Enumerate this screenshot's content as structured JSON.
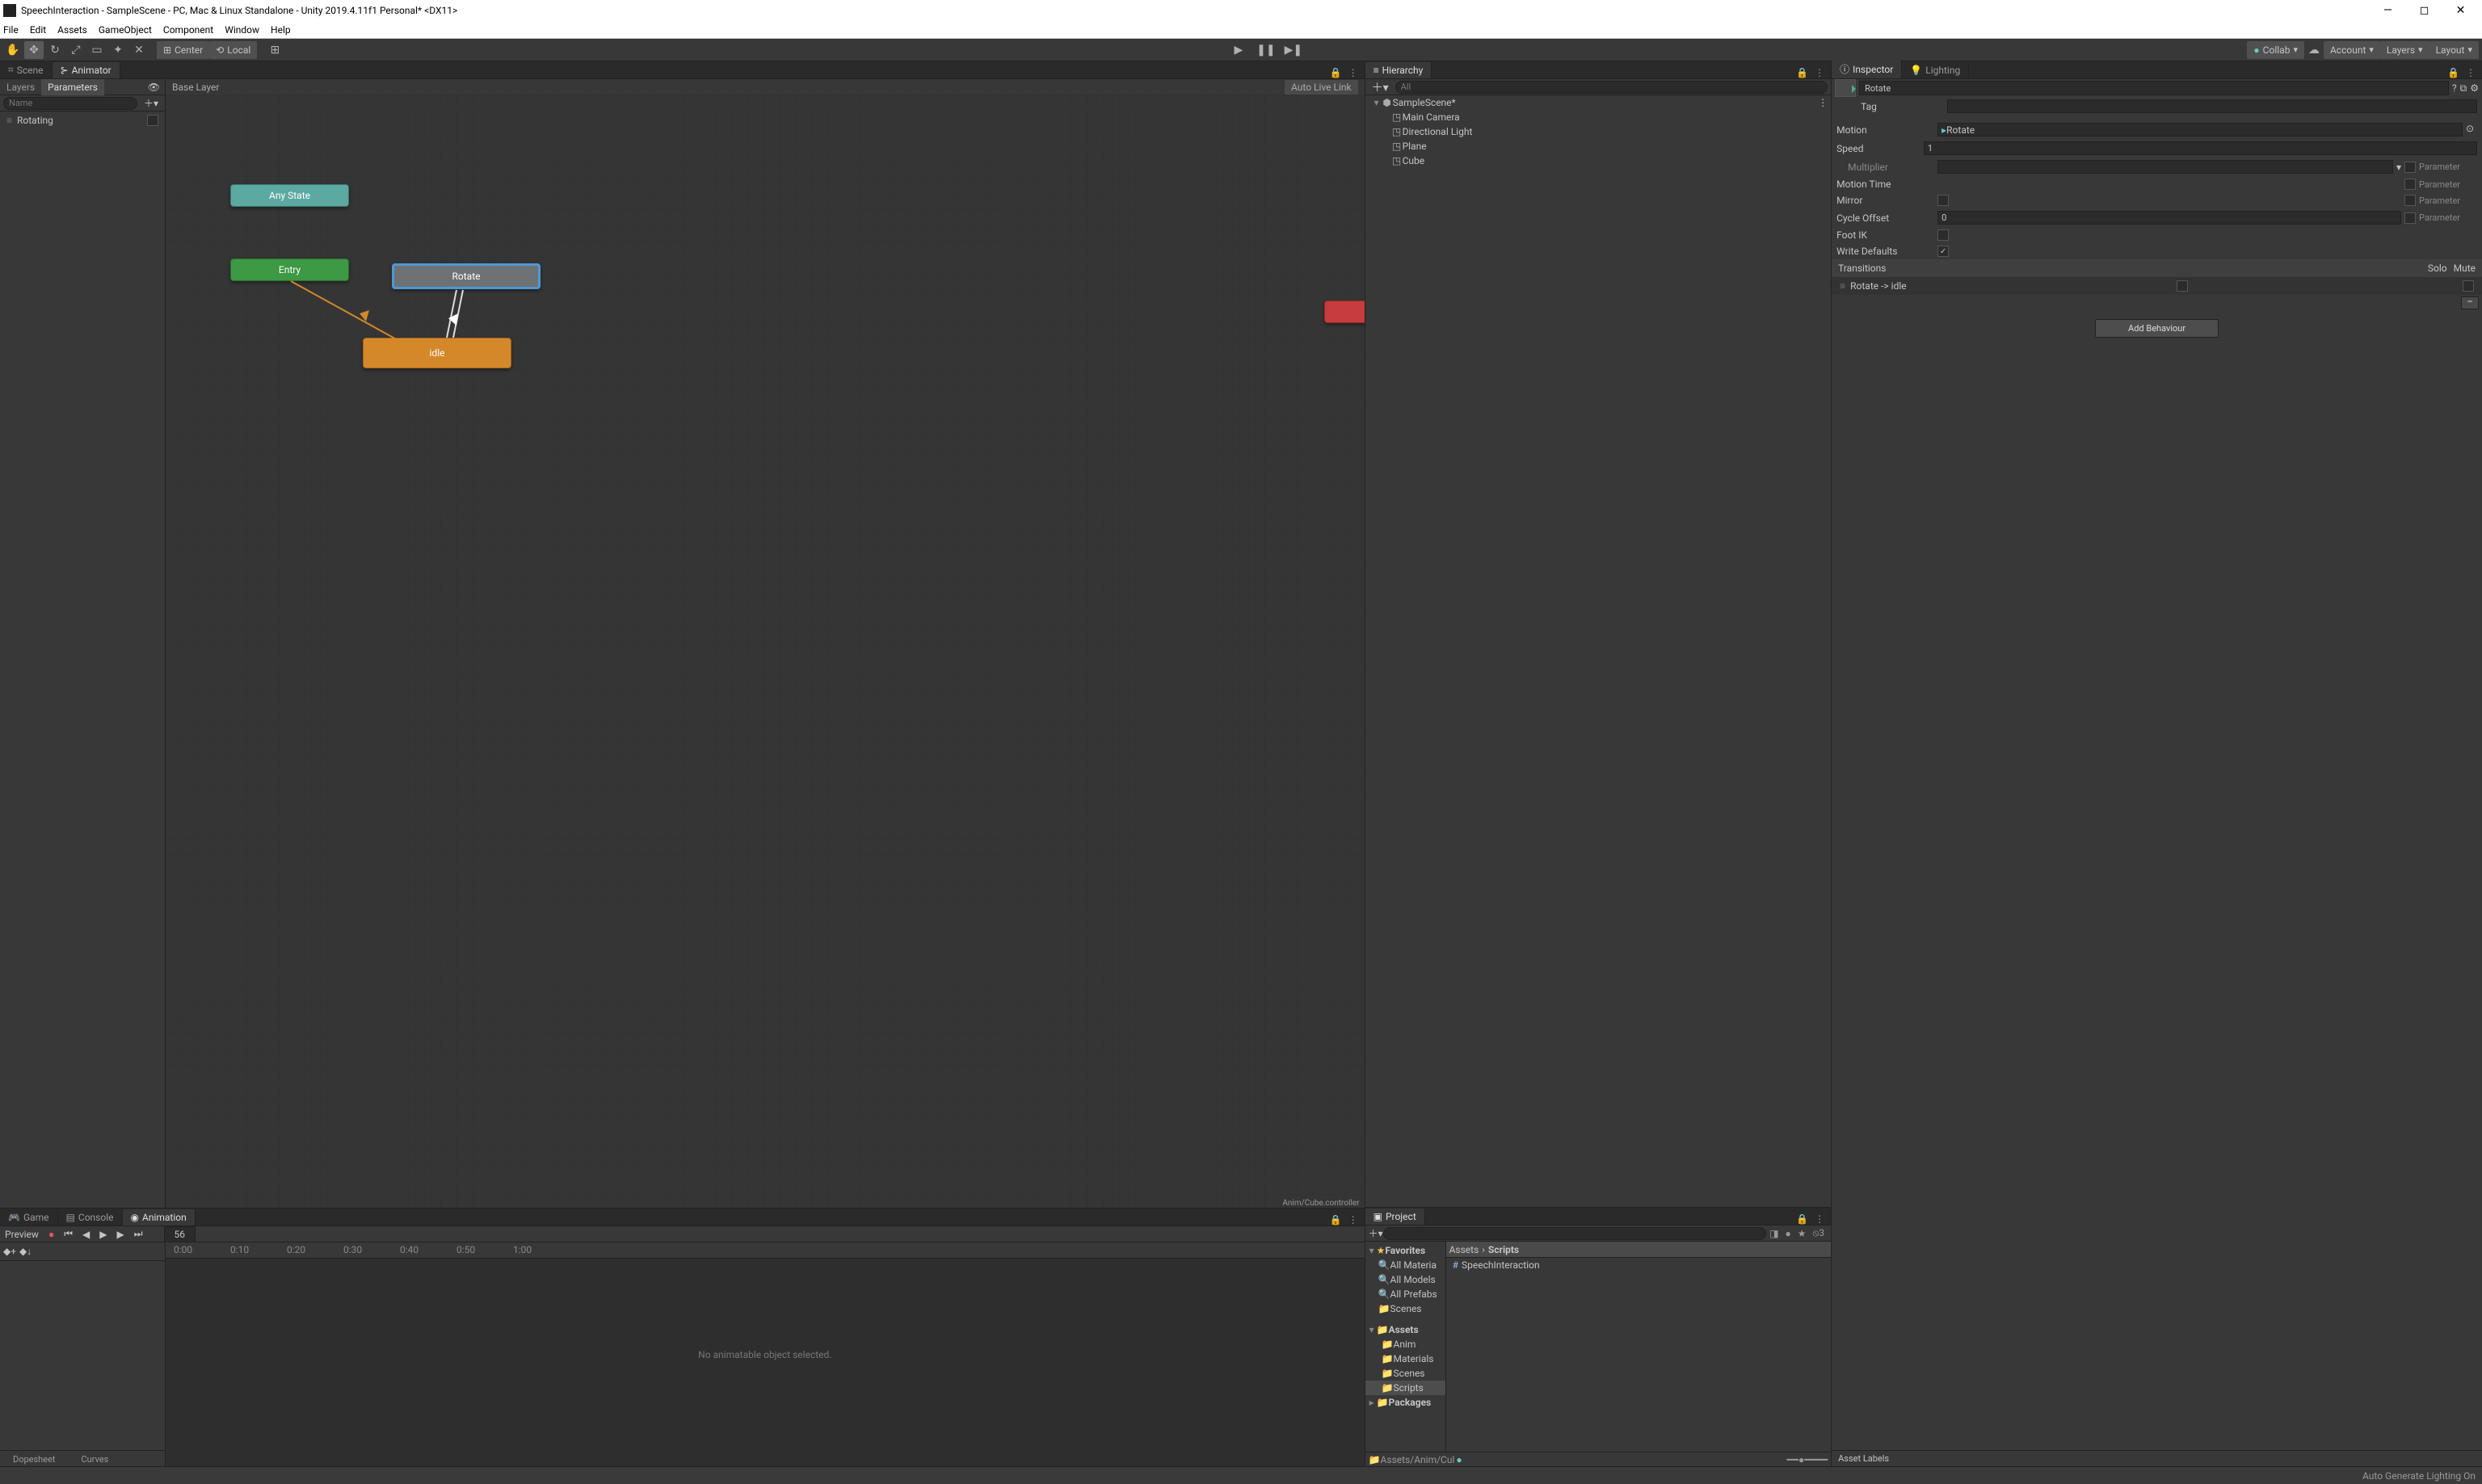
{
  "title": "SpeechInteraction - SampleScene - PC, Mac & Linux Standalone - Unity 2019.4.11f1 Personal* <DX11>",
  "menu": [
    "File",
    "Edit",
    "Assets",
    "GameObject",
    "Component",
    "Window",
    "Help"
  ],
  "toolbar": {
    "center": "Center",
    "local": "Local",
    "collab": "Collab",
    "account": "Account",
    "layers": "Layers",
    "layout": "Layout"
  },
  "tabs": {
    "scene": "Scene",
    "animator": "Animator"
  },
  "paramTabs": {
    "layers": "Layers",
    "parameters": "Parameters"
  },
  "paramSearchPlaceholder": "Name",
  "paramItem": "Rotating",
  "graph": {
    "breadcrumb": "Base Layer",
    "autolink": "Auto Live Link",
    "footer": "Anim/Cube.controller",
    "nodes": {
      "anystate": "Any State",
      "entry": "Entry",
      "rotate": "Rotate",
      "idle": "idle"
    }
  },
  "bottomTabs": {
    "game": "Game",
    "console": "Console",
    "animation": "Animation"
  },
  "animToolbar": {
    "preview": "Preview",
    "frame": "56"
  },
  "timelineTicks": [
    "0:00",
    "0:10",
    "0:20",
    "0:30",
    "0:40",
    "0:50",
    "1:00"
  ],
  "noAnim": "No animatable object selected.",
  "animFooter": {
    "dopesheet": "Dopesheet",
    "curves": "Curves"
  },
  "hierTab": "Hierarchy",
  "hierSearchPlaceholder": "All",
  "hierarchy": {
    "scene": "SampleScene*",
    "items": [
      "Main Camera",
      "Directional Light",
      "Plane",
      "Cube"
    ]
  },
  "projectTab": "Project",
  "projectTree": {
    "favorites": "Favorites",
    "favItems": [
      "All Materia",
      "All Models",
      "All Prefabs"
    ],
    "scenes": "Scenes",
    "assets": "Assets",
    "assetItems": [
      "Anim",
      "Materials",
      "Scenes",
      "Scripts"
    ],
    "packages": "Packages"
  },
  "projectCrumbs": [
    "Assets",
    "Scripts"
  ],
  "projectFiles": [
    "SpeechInteraction"
  ],
  "projectFooter": "Assets/Anim/Cul",
  "projectCount": "3",
  "inspectorTab": "Inspector",
  "lightingTab": "Lighting",
  "inspector": {
    "name": "Rotate",
    "tag": "Tag",
    "motion": {
      "label": "Motion",
      "value": "Rotate"
    },
    "speed": {
      "label": "Speed",
      "value": "1"
    },
    "multiplier": "Multiplier",
    "motionTime": "Motion Time",
    "mirror": "Mirror",
    "cycleOffset": {
      "label": "Cycle Offset",
      "value": "0"
    },
    "footIK": "Foot IK",
    "writeDefaults": "Write Defaults",
    "parameter": "Parameter",
    "transitions": "Transitions",
    "solo": "Solo",
    "mute": "Mute",
    "transItem": "Rotate -> idle",
    "addBehaviour": "Add Behaviour"
  },
  "assetLabels": "Asset Labels",
  "statusbar": "Auto Generate Lighting On"
}
